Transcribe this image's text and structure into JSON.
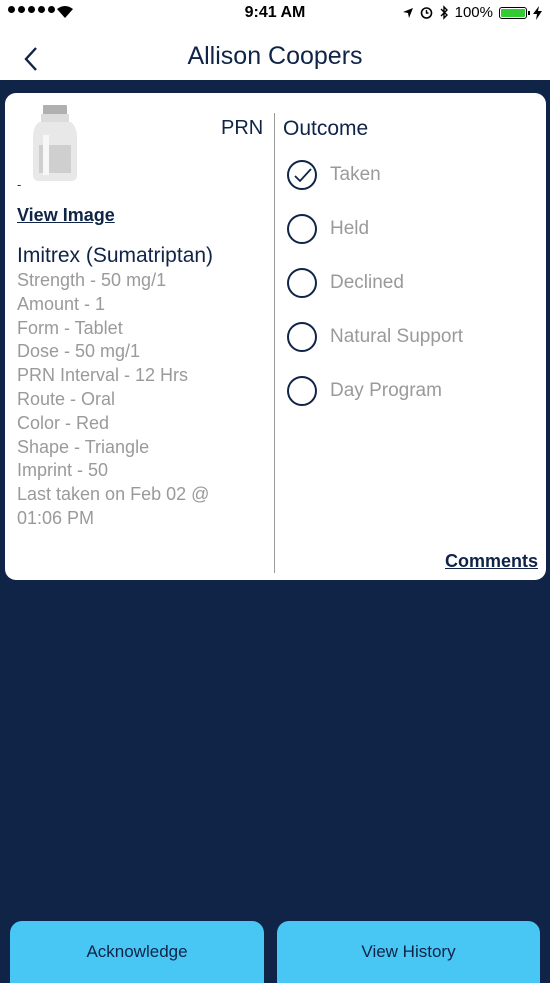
{
  "status_bar": {
    "time": "9:41 AM",
    "battery": "100%",
    "battery_color": "#33cc33"
  },
  "header": {
    "title": "Allison Coopers",
    "back_icon": "chevron-left-icon"
  },
  "medication": {
    "image_icon": "pill-bottle-icon",
    "image_caption": "-",
    "view_image_label": "View Image",
    "type_label": "PRN",
    "name": "Imitrex (Sumatriptan)",
    "details": [
      "Strength - 50 mg/1",
      "Amount - 1",
      "Form - Tablet",
      "Dose - 50 mg/1",
      "PRN Interval - 12 Hrs",
      "Route - Oral",
      "Color - Red",
      "Shape - Triangle",
      "Imprint - 50",
      "Last taken on Feb 02 @",
      "01:06 PM"
    ]
  },
  "outcome": {
    "title": "Outcome",
    "options": [
      {
        "label": "Taken",
        "checked": true
      },
      {
        "label": "Held",
        "checked": false
      },
      {
        "label": "Declined",
        "checked": false
      },
      {
        "label": "Natural Support",
        "checked": false
      },
      {
        "label": "Day Program",
        "checked": false
      }
    ],
    "comments_label": "Comments"
  },
  "actions": {
    "acknowledge_label": "Acknowledge",
    "view_history_label": "View History"
  },
  "colors": {
    "navy": "#0f2447",
    "accent_button": "#48c7f4",
    "muted_text": "#9a9a9a"
  }
}
